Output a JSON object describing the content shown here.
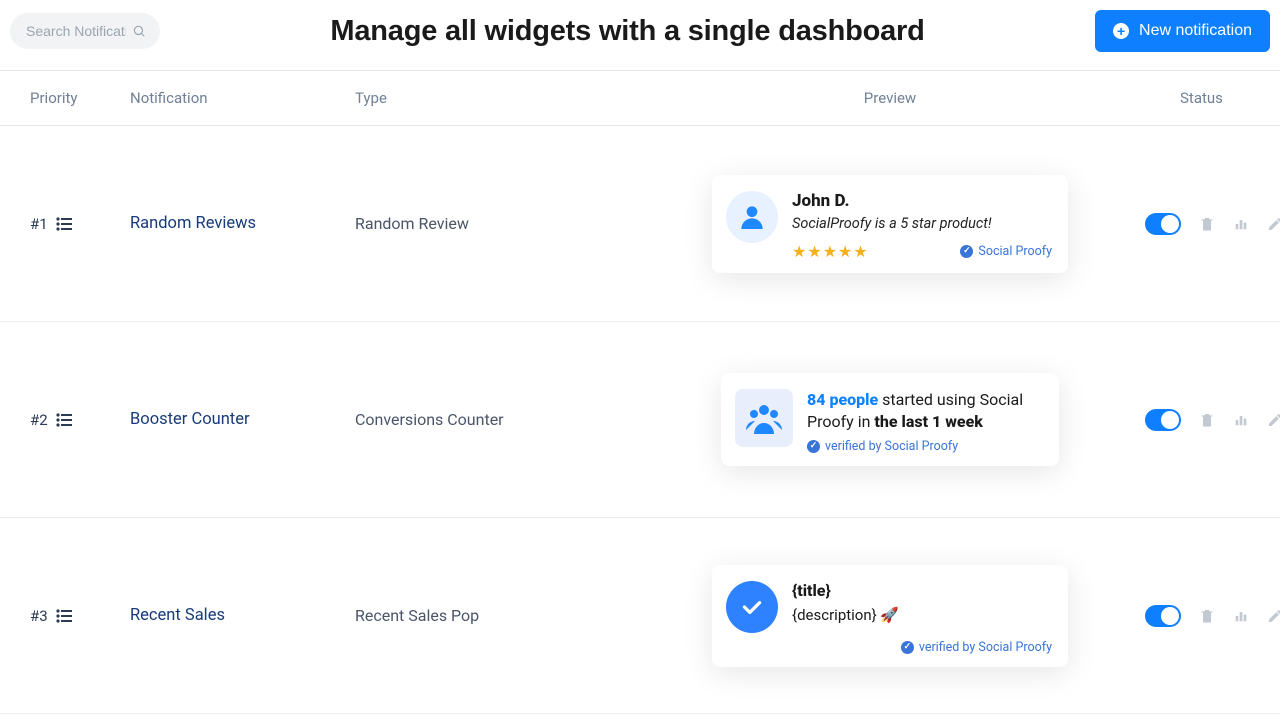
{
  "header": {
    "search_placeholder": "Search Notification",
    "title": "Manage all widgets with a single dashboard",
    "new_button": "New notification"
  },
  "columns": {
    "priority": "Priority",
    "notification": "Notification",
    "type": "Type",
    "preview": "Preview",
    "status": "Status"
  },
  "rows": [
    {
      "priority": "#1",
      "name": "Random Reviews",
      "type": "Random Review",
      "toggle": true,
      "preview": {
        "kind": "review",
        "author": "John D.",
        "text": "SocialProofy is a 5 star product!",
        "stars": "★★★★★",
        "verified_label": "Social Proofy"
      }
    },
    {
      "priority": "#2",
      "name": "Booster Counter",
      "type": "Conversions Counter",
      "toggle": true,
      "preview": {
        "kind": "booster",
        "count_text": "84 people",
        "mid_text": " started using Social Proofy in ",
        "tail_text": "the last 1 week",
        "verified_label": "verified by Social Proofy"
      }
    },
    {
      "priority": "#3",
      "name": "Recent Sales",
      "type": "Recent Sales Pop",
      "toggle": true,
      "preview": {
        "kind": "sales",
        "title": "{title}",
        "desc": "{description} 🚀",
        "verified_label": "verified by Social Proofy"
      }
    }
  ]
}
